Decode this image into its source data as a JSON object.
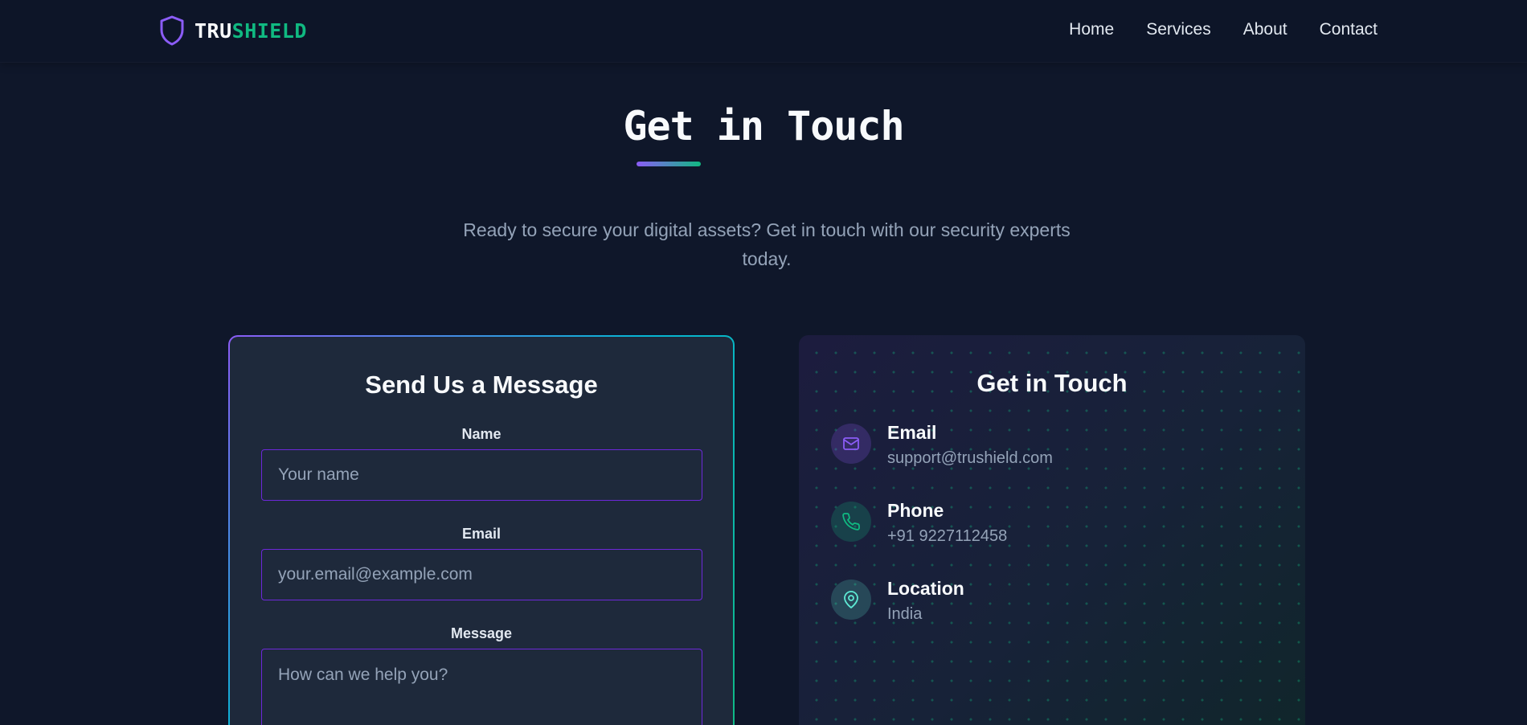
{
  "header": {
    "brand_part1": "TRU",
    "brand_part2": "SHIELD",
    "nav": [
      "Home",
      "Services",
      "About",
      "Contact"
    ]
  },
  "hero": {
    "title": "Get in Touch",
    "subtitle": "Ready to secure your digital assets? Get in touch with our security experts today."
  },
  "form": {
    "title": "Send Us a Message",
    "name_label": "Name",
    "name_placeholder": "Your name",
    "email_label": "Email",
    "email_placeholder": "your.email@example.com",
    "message_label": "Message",
    "message_placeholder": "How can we help you?"
  },
  "info": {
    "title": "Get in Touch",
    "items": [
      {
        "label": "Email",
        "value": "support@trushield.com",
        "icon": "mail-icon"
      },
      {
        "label": "Phone",
        "value": "+91 9227112458",
        "icon": "phone-icon"
      },
      {
        "label": "Location",
        "value": "India",
        "icon": "map-pin-icon"
      }
    ]
  },
  "colors": {
    "background": "#0f172a",
    "brand_purple": "#8b5cf6",
    "brand_green": "#10b981",
    "card": "#1e293b"
  }
}
